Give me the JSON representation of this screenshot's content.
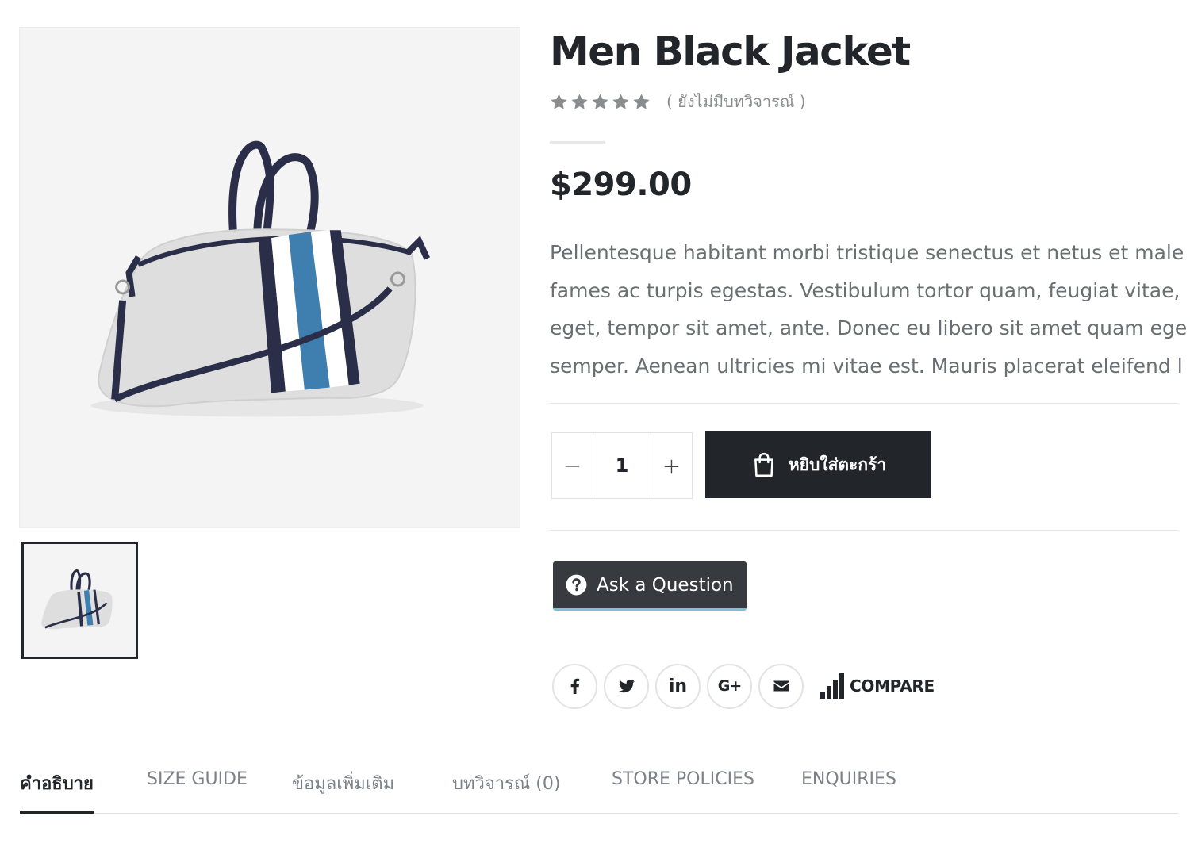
{
  "product": {
    "title": "Men Black Jacket",
    "rating": 0,
    "rating_max": 5,
    "review_text": "( ยังไม่มีบทวิจารณ์ )",
    "price": "$299.00",
    "description_lines": [
      "Pellentesque habitant morbi tristique senectus et netus et male",
      "fames ac turpis egestas. Vestibulum tortor quam, feugiat vitae,",
      "eget, tempor sit amet, ante. Donec eu libero sit amet quam ege",
      "semper. Aenean ultricies mi vitae est. Mauris placerat eleifend l"
    ]
  },
  "gallery": {
    "main_image_icon": "duffel-bag-photo",
    "thumbnail_icon": "duffel-bag-photo"
  },
  "cart": {
    "minus_label": "−",
    "plus_label": "+",
    "quantity": "1",
    "add_to_cart_label": "หยิบใส่ตะกร้า",
    "cart_icon": "shopping-bag-icon"
  },
  "ask": {
    "label": "Ask a Question",
    "icon": "question-circle-icon"
  },
  "share": {
    "facebook_icon": "facebook-icon",
    "twitter_icon": "twitter-icon",
    "linkedin_label": "in",
    "googleplus_label": "G+",
    "email_icon": "envelope-icon",
    "compare_label": "COMPARE",
    "compare_icon": "bar-chart-icon"
  },
  "tabs": [
    {
      "label": "คำอธิบาย",
      "active": true
    },
    {
      "label": "SIZE GUIDE",
      "active": false
    },
    {
      "label": "ข้อมูลเพิ่มเติม",
      "active": false
    },
    {
      "label": "บทวิจารณ์ (0)",
      "active": false
    },
    {
      "label": "STORE POLICIES",
      "active": false
    },
    {
      "label": "ENQUIRIES",
      "active": false
    }
  ],
  "colors": {
    "primary_dark": "#222529",
    "ask_button": "#373a3f",
    "ask_accent": "#7cc2d2",
    "star_empty": "#8a8c90",
    "bag_blue_stripe": "#3e7fb0",
    "bag_navy": "#2b2e48"
  }
}
